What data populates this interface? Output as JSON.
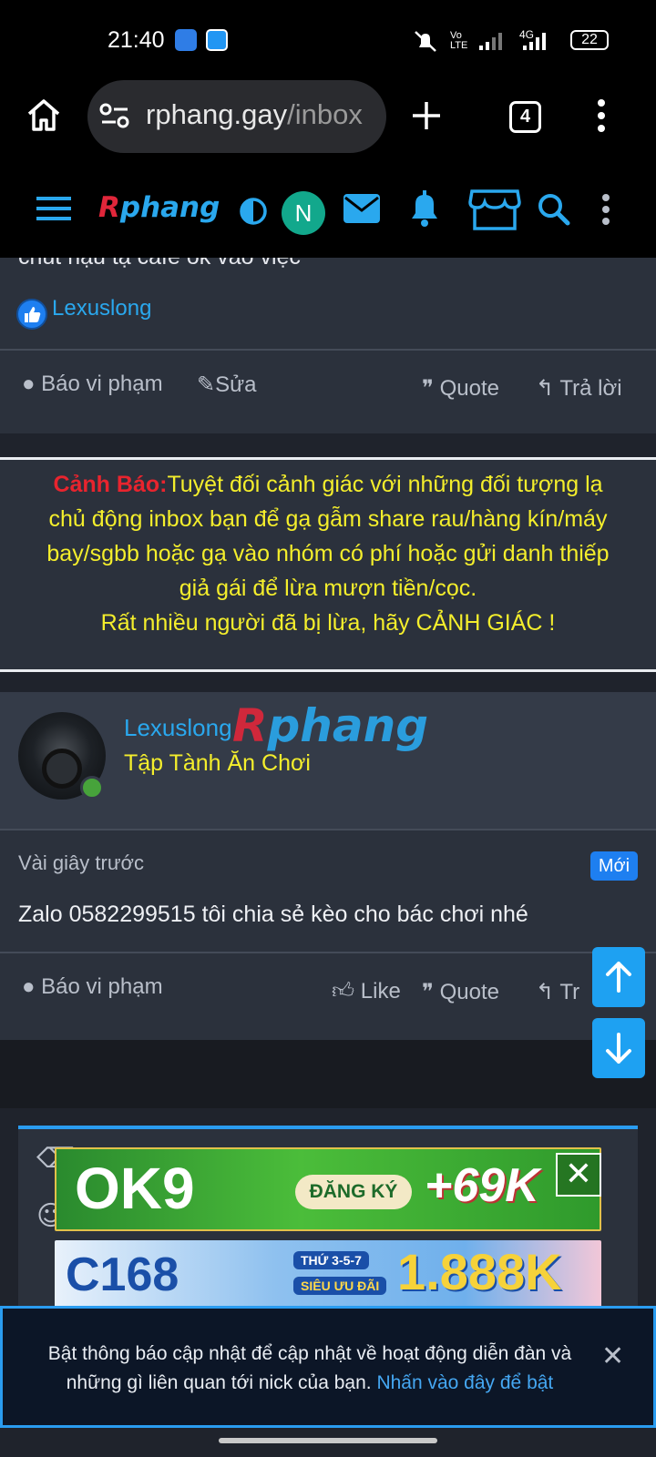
{
  "status_bar": {
    "time": "21:40",
    "battery": "22",
    "volte": "Vo LTE",
    "network": "4G"
  },
  "browser": {
    "url_host": "rphang.gay",
    "url_path": "/inbox",
    "tab_count": "4"
  },
  "site": {
    "logo_r": "R",
    "logo_rest": "phang",
    "user_initial": "N"
  },
  "prev_post": {
    "text_tail": "chút hậu tạ cafe ok vào việc",
    "reaction_user": "Lexuslong",
    "actions": {
      "report": "Báo vi phạm",
      "edit": "Sửa",
      "quote": "Quote",
      "reply": "Trả lời"
    }
  },
  "warning": {
    "label": "Cảnh Báo:",
    "line1": "Tuyệt đối cảnh giác với những đối tượng lạ",
    "line2": "chủ động inbox bạn để gạ gẫm share rau/hàng kín/máy",
    "line3": "bay/sgbb hoặc gạ vào nhóm có phí hoặc gửi danh thiếp",
    "line4": "giả gái để lừa mượn tiền/cọc.",
    "line5": "Rất nhiều người đã bị lừa, hãy CẢNH GIÁC !"
  },
  "post": {
    "username": "Lexuslong",
    "user_title": "Tập Tành Ăn Chơi",
    "time": "Vài giây trước",
    "badge": "Mới",
    "content": "Zalo 0582299515 tôi chia sẻ kèo cho bác chơi nhé",
    "actions": {
      "report": "Báo vi phạm",
      "like": "Like",
      "quote": "Quote",
      "reply_partial": "Tr"
    }
  },
  "ads": {
    "ad1": {
      "brand": "OK9",
      "cta": "ĐĂNG KÝ",
      "bonus": "+69K"
    },
    "ad2": {
      "brand": "C168",
      "days": "THỨ 3-5-7",
      "promo": "SIÊU ƯU ĐÃI",
      "amount": "1.888K"
    }
  },
  "notification": {
    "text": "Bật thông báo cập nhật để cập nhật về hoạt động diễn đàn và những gì liên quan tới nick của bạn. ",
    "link": "Nhấn vào đây để bật"
  },
  "colors": {
    "accent": "#2aa8ee",
    "warning_text": "#f4ee2c",
    "warning_label": "#e8242e",
    "badge": "#1e7ff0"
  }
}
